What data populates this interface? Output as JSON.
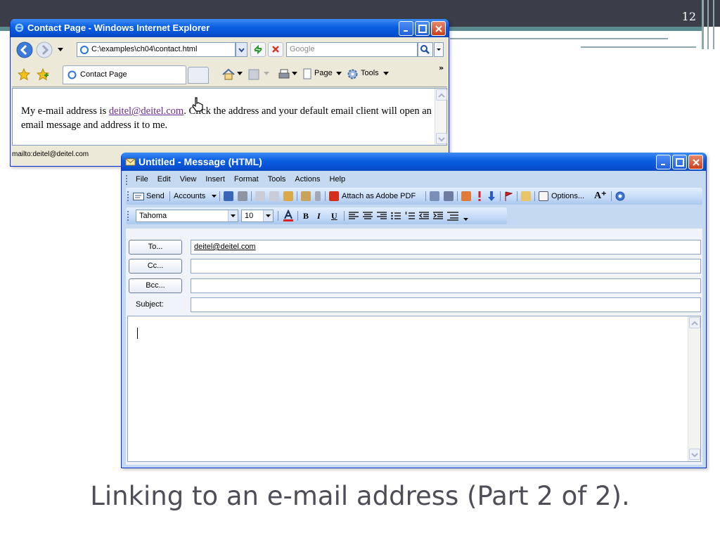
{
  "slide": {
    "number": "12",
    "caption": "Linking to an e-mail address (Part 2 of 2)."
  },
  "ie": {
    "title": "Contact Page - Windows Internet Explorer",
    "address": "C:\\examples\\ch04\\contact.html",
    "search_placeholder": "Google",
    "tab_label": "Contact Page",
    "toolbar": {
      "page": "Page",
      "tools": "Tools"
    },
    "content": {
      "before_link": "My e-mail address is ",
      "link": "deitel@deitel.com",
      "after_link": ". Click the address and your default email client will open an email message and address it to me."
    },
    "status": "mailto:deitel@deitel.com"
  },
  "message": {
    "title": "Untitled - Message (HTML)",
    "menu": [
      "File",
      "Edit",
      "View",
      "Insert",
      "Format",
      "Tools",
      "Actions",
      "Help"
    ],
    "toolbar": {
      "send": "Send",
      "accounts": "Accounts",
      "attach_pdf": "Attach as Adobe PDF",
      "options": "Options..."
    },
    "format": {
      "font": "Tahoma",
      "size": "10"
    },
    "fields": {
      "to_button": "To...",
      "cc_button": "Cc...",
      "bcc_button": "Bcc...",
      "subject_label": "Subject:",
      "to_value": "deitel@deitel.com",
      "cc_value": "",
      "bcc_value": "",
      "subject_value": ""
    }
  },
  "colors": {
    "xp_blue": "#0a5ee0",
    "slide_bar": "#3b3d49",
    "accent_teal": "#5c8b8f"
  }
}
